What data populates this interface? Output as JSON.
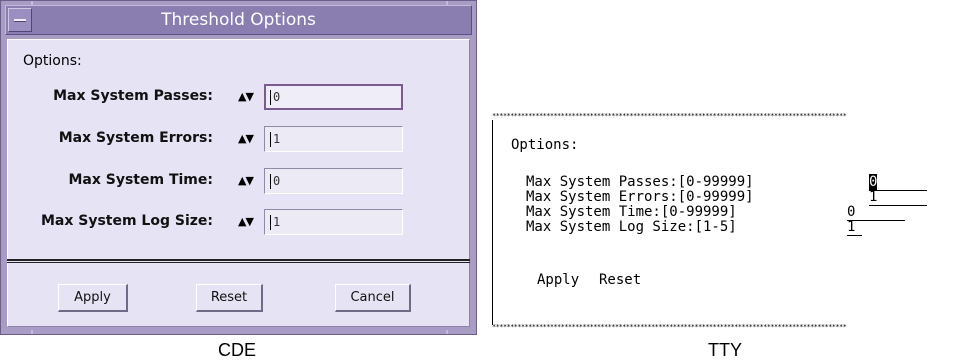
{
  "cde": {
    "title": "Threshold Options",
    "options_label": "Options:",
    "fields": [
      {
        "label": "Max System Passes:",
        "value": "0",
        "arrows": "▲▼"
      },
      {
        "label": "Max System Errors:",
        "value": "1",
        "arrows": "▲▼"
      },
      {
        "label": "Max System Time:",
        "value": "0",
        "arrows": "▲▼"
      },
      {
        "label": "Max System Log Size:",
        "value": "1",
        "arrows": "▲▼"
      }
    ],
    "buttons": {
      "apply": "Apply",
      "reset": "Reset",
      "cancel": "Cancel"
    },
    "caption": "CDE",
    "colors": {
      "frame": "#a89cc4",
      "titlebar": "#8a7eb1",
      "body": "#e6e3f4"
    }
  },
  "tty": {
    "border": "**************************************************************************************************",
    "options_label": "Options:",
    "lines": [
      {
        "text": "Max System Passes:[0-99999]",
        "value": "0"
      },
      {
        "text": "Max System Errors:[0-99999]",
        "value": "1"
      },
      {
        "text": "Max System Time:[0-99999]",
        "value": "0"
      },
      {
        "text": "Max System Log Size:[1-5]",
        "value": "1"
      }
    ],
    "actions": {
      "apply": "Apply",
      "reset": "Reset"
    },
    "caption": "TTY"
  }
}
